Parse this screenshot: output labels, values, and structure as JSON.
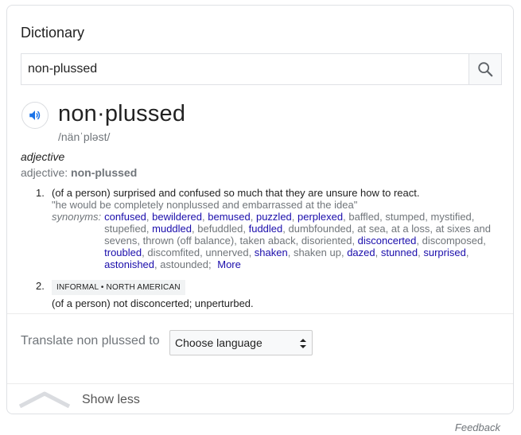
{
  "card": {
    "title": "Dictionary",
    "search": {
      "value": "non-plussed",
      "icon": "search-icon"
    },
    "entry": {
      "headword": "non·plussed",
      "phonetic": "/nänˈpləst/",
      "speaker_icon": "speaker-icon",
      "pos": "adjective",
      "pos_label": "adjective: ",
      "pos_form": "non-plussed",
      "senses": [
        {
          "number": "1.",
          "definition": "(of a person) surprised and confused so much that they are unsure how to react.",
          "example": "\"he would be completely nonplussed and embarrassed at the idea\"",
          "synonyms_label": "synonyms:",
          "synonyms": [
            {
              "text": "confused",
              "link": true
            },
            {
              "text": "bewildered",
              "link": true
            },
            {
              "text": "bemused",
              "link": true
            },
            {
              "text": "puzzled",
              "link": true
            },
            {
              "text": "perplexed",
              "link": true
            },
            {
              "text": "baffled",
              "link": false
            },
            {
              "text": "stumped",
              "link": false
            },
            {
              "text": "mystified",
              "link": false
            },
            {
              "text": "stupefied",
              "link": false
            },
            {
              "text": "muddled",
              "link": true
            },
            {
              "text": "befuddled",
              "link": false
            },
            {
              "text": "fuddled",
              "link": true
            },
            {
              "text": "dumbfounded",
              "link": false
            },
            {
              "text": "at sea",
              "link": false
            },
            {
              "text": "at a loss",
              "link": false
            },
            {
              "text": "at sixes and sevens",
              "link": false
            },
            {
              "text": "thrown (off balance)",
              "link": false
            },
            {
              "text": "taken aback",
              "link": false
            },
            {
              "text": "disoriented",
              "link": false
            },
            {
              "text": "disconcerted",
              "link": true
            },
            {
              "text": "discomposed",
              "link": false
            },
            {
              "text": "troubled",
              "link": true
            },
            {
              "text": "discomfited",
              "link": false
            },
            {
              "text": "unnerved",
              "link": false
            },
            {
              "text": "shaken",
              "link": true
            },
            {
              "text": "shaken up",
              "link": false
            },
            {
              "text": "dazed",
              "link": true
            },
            {
              "text": "stunned",
              "link": true
            },
            {
              "text": "surprised",
              "link": true
            },
            {
              "text": "astonished",
              "link": true
            },
            {
              "text": "astounded",
              "link": false
            }
          ],
          "more_label": "More"
        },
        {
          "number": "2.",
          "badge": "INFORMAL • NORTH AMERICAN",
          "definition": "(of a person) not disconcerted; unperturbed."
        }
      ]
    },
    "translate": {
      "label": "Translate non plussed to",
      "select_value": "Choose language"
    },
    "show_less_label": "Show less"
  },
  "feedback_label": "Feedback",
  "colors": {
    "link": "#1a0dab",
    "speaker": "#1a73e8",
    "muted": "#70757a"
  }
}
